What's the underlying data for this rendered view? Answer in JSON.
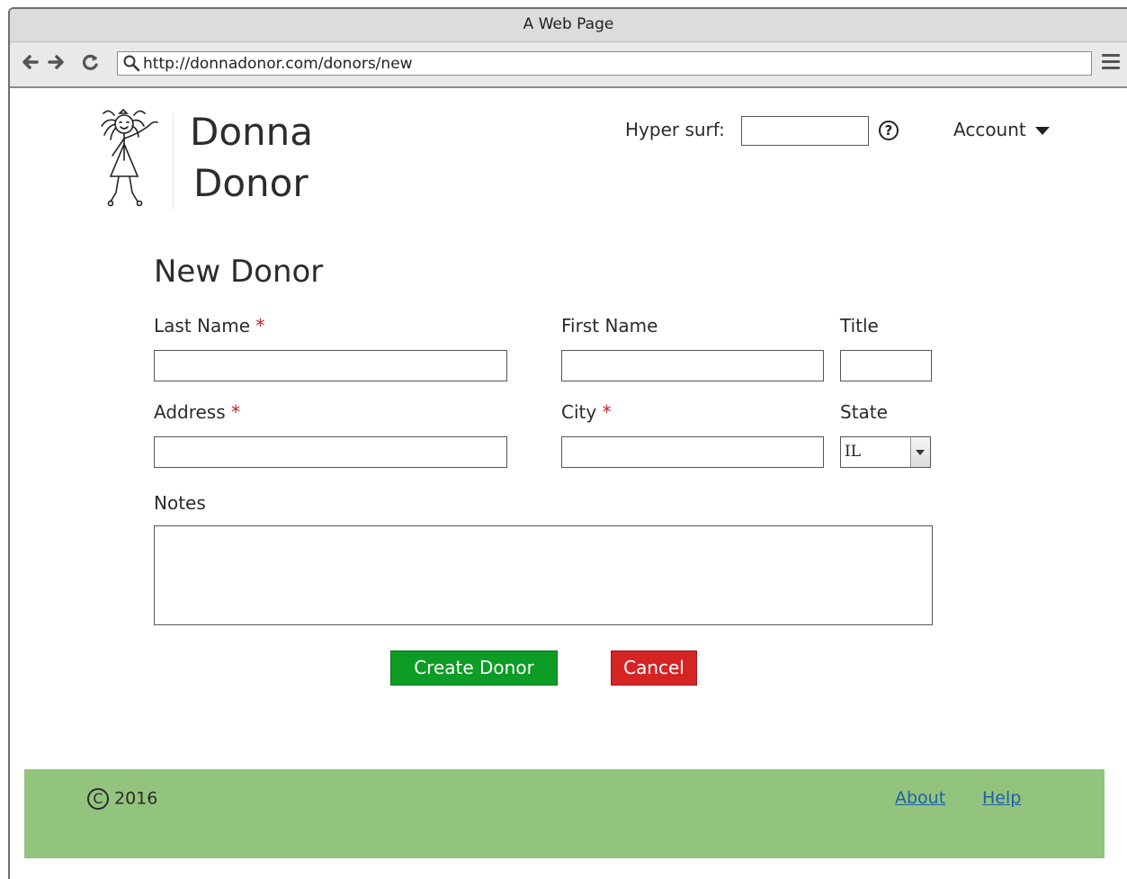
{
  "browser": {
    "window_title": "A Web Page",
    "url": "http://donnadonor.com/donors/new"
  },
  "header": {
    "brand_line1": "Donna",
    "brand_line2": "Donor",
    "hyper_surf_label": "Hyper surf:",
    "hyper_surf_value": "",
    "help_symbol": "?",
    "account_label": "Account"
  },
  "form": {
    "title": "New Donor",
    "required_marker": "*",
    "fields": {
      "last_name": {
        "label": "Last Name",
        "value": ""
      },
      "first_name": {
        "label": "First Name",
        "value": ""
      },
      "title": {
        "label": "Title",
        "value": ""
      },
      "address": {
        "label": "Address",
        "value": ""
      },
      "city": {
        "label": "City",
        "value": ""
      },
      "state": {
        "label": "State",
        "value": "IL"
      },
      "notes": {
        "label": "Notes",
        "value": ""
      }
    },
    "create_button": "Create Donor",
    "cancel_button": "Cancel"
  },
  "footer": {
    "copyright_symbol": "C",
    "year": "2016",
    "links": [
      "About",
      "Help"
    ]
  },
  "colors": {
    "create": "#0d9c25",
    "cancel": "#d52424",
    "footer_bg": "#93c47d",
    "required": "#c8202b",
    "link": "#1f5fa6"
  },
  "icons": [
    "back-arrow-icon",
    "forward-arrow-icon",
    "reload-icon",
    "search-icon",
    "hamburger-menu-icon",
    "help-icon",
    "caret-down-icon",
    "copyright-icon",
    "logo-stick-girl"
  ]
}
